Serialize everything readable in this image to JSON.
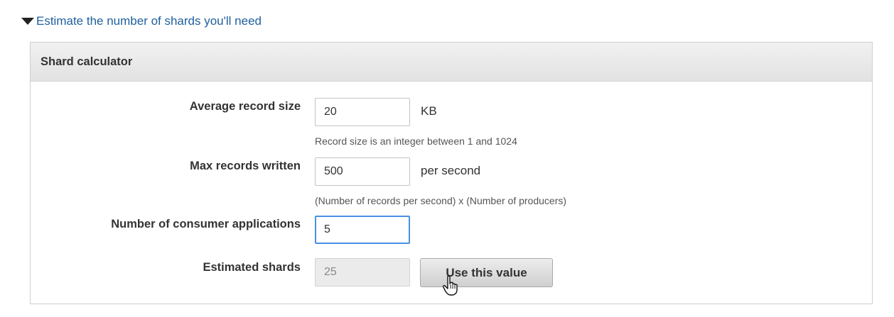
{
  "toggle": {
    "label": "Estimate the number of shards you'll need",
    "icon": "triangle-down-icon"
  },
  "calculator": {
    "title": "Shard calculator",
    "fields": {
      "record_size": {
        "label": "Average record size",
        "value": "20",
        "unit": "KB",
        "hint": "Record size is an integer between 1 and 1024"
      },
      "max_records": {
        "label": "Max records written",
        "value": "500",
        "unit": "per second",
        "hint": "(Number of records per second) x (Number of producers)"
      },
      "consumers": {
        "label": "Number of consumer applications",
        "value": "5"
      },
      "estimated": {
        "label": "Estimated shards",
        "value": "25"
      }
    },
    "use_value_button": "Use this value"
  },
  "cursor": {
    "icon": "hand-pointer-icon"
  },
  "colors": {
    "link": "#1f5f9e",
    "focus": "#4a90e2"
  }
}
